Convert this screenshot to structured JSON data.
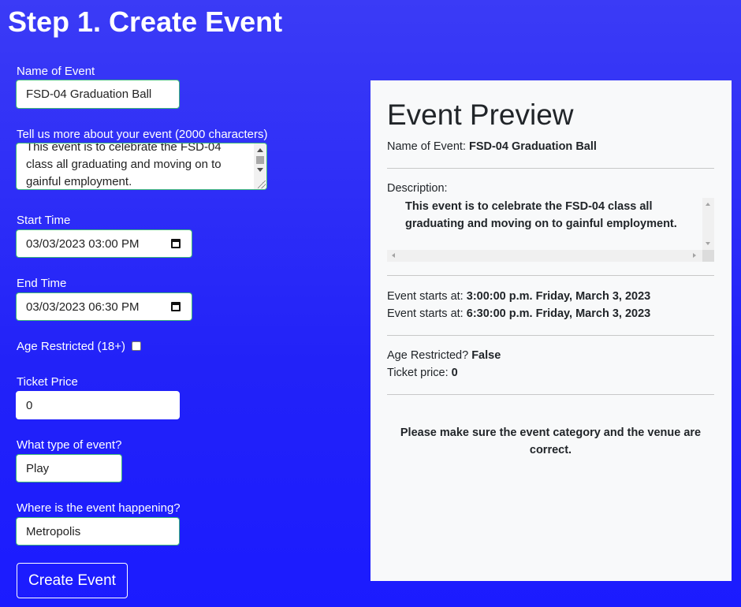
{
  "page": {
    "title": "Step 1. Create Event"
  },
  "form": {
    "name": {
      "label": "Name of Event",
      "value": "FSD-04 Graduation Ball"
    },
    "description": {
      "label": "Tell us more about your event (2000 characters)",
      "value": "This event is to celebrate the FSD-04 class all graduating and moving on to gainful employment."
    },
    "start_time": {
      "label": "Start Time",
      "value": "03/03/2023 03:00 PM"
    },
    "end_time": {
      "label": "End Time",
      "value": "03/03/2023 06:30 PM"
    },
    "age_restricted": {
      "label": "Age Restricted (18+)",
      "checked": false
    },
    "ticket_price": {
      "label": "Ticket Price",
      "value": "0"
    },
    "event_type": {
      "label": "What type of event?",
      "value": "Play"
    },
    "venue": {
      "label": "Where is the event happening?",
      "value": "Metropolis"
    },
    "submit_label": "Create Event"
  },
  "preview": {
    "title": "Event Preview",
    "name_label": "Name of Event:",
    "name_value": "FSD-04 Graduation Ball",
    "description_label": "Description:",
    "description_value": "This event is to celebrate the FSD-04 class all graduating and moving on to gainful employment.",
    "start_label": "Event starts at:",
    "start_value": "3:00:00 p.m. Friday, March 3, 2023",
    "end_label": "Event starts at:",
    "end_value": "6:30:00 p.m. Friday, March 3, 2023",
    "age_label": "Age Restricted?",
    "age_value": "False",
    "price_label": "Ticket price:",
    "price_value": "0",
    "notice": "Please make sure the event category and the venue are correct."
  },
  "colors": {
    "background": "#2424f8",
    "input_border": "#3bb57b",
    "panel": "#f8f9fa"
  }
}
